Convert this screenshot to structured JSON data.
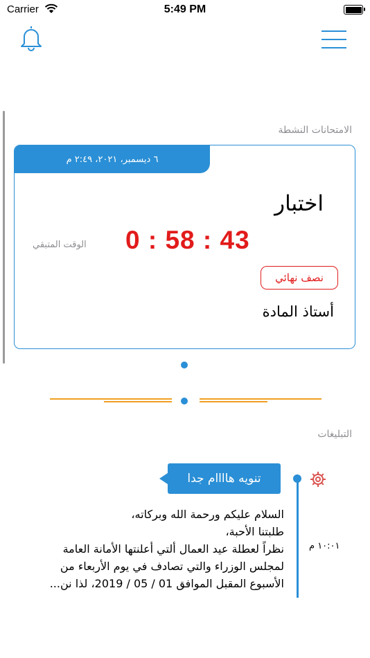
{
  "status_bar": {
    "carrier": "Carrier",
    "time": "5:49 PM",
    "battery_level": 1.0
  },
  "header": {
    "notifications_icon": "bell-icon",
    "menu_icon": "hamburger-menu-icon"
  },
  "active_exams": {
    "section_title": "الامتحانات النشطة",
    "card": {
      "date": "٦ ديسمبر، ٢٠٢١، ٢:٤٩ م",
      "title": "اختبار",
      "countdown": "0 : 58 : 43",
      "time_left_label": "الوقت المتبقي",
      "exam_type": "نصف نهائي",
      "teacher": "أستاذ المادة"
    }
  },
  "announcements": {
    "section_title": "التبليغات",
    "items": [
      {
        "tag": "تنويه هاااام جدا",
        "body_line1": "السلام عليكم ورحمة الله وبركاته،",
        "body_line2": "طلبتنا الأحبة،",
        "body_line3": "نظراً لعطلة عيد العمال ألتي أعلنتها الأمانة العامة",
        "body_line4": "لمجلس الوزراء والتي تصادف في يوم الأربعاء من",
        "body_line5": "الأسبوع المقبل الموافق 01 / 05 / 2019، لذا نن...",
        "time": "١٠:٠١ م",
        "icon": "gear-icon"
      }
    ]
  },
  "colors": {
    "accent": "#2a8fd6",
    "alert": "#e21b1b",
    "muted": "#8e8e93",
    "ornament": "#f0a020"
  }
}
